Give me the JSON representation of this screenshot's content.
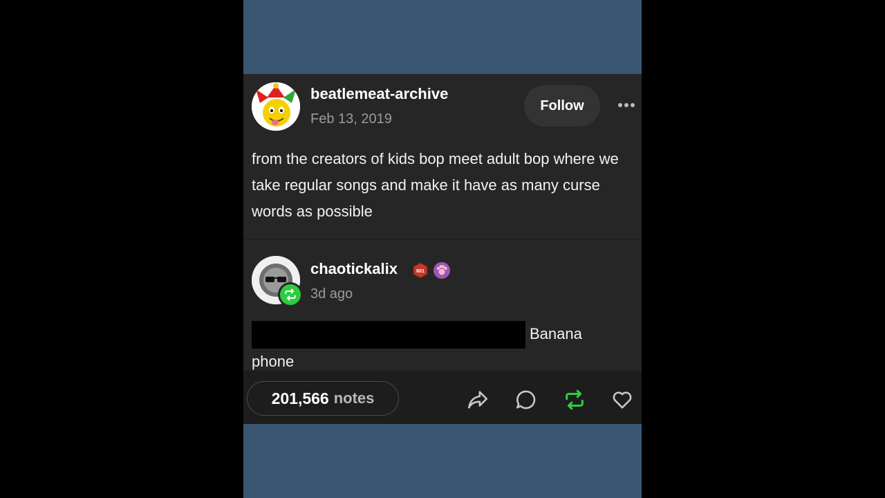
{
  "post": {
    "username": "beatlemeat-archive",
    "date": "Feb 13, 2019",
    "follow_label": "Follow",
    "body": "from the creators of kids bop meet adult bop where we take regular songs and make it have as many curse words as possible"
  },
  "reblog": {
    "username": "chaotickalix",
    "badge1_text": "601",
    "time": "3d ago",
    "body": "Banana phone"
  },
  "footer": {
    "notes_count": "201,566",
    "notes_label": "notes"
  },
  "colors": {
    "card_bg": "#262626",
    "page_bg": "#3a5673",
    "reblog_green": "#2ecc40"
  }
}
